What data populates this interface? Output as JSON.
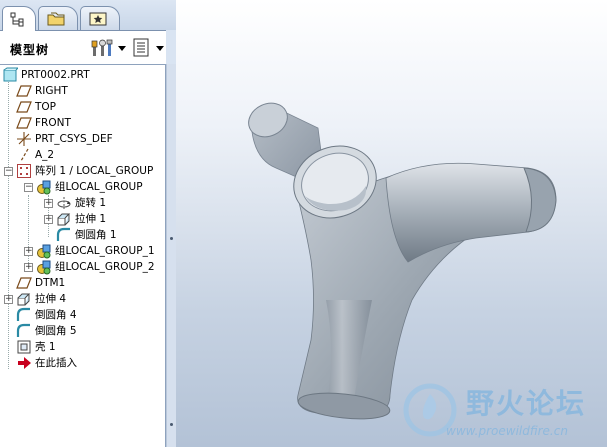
{
  "panel": {
    "title": "模型树"
  },
  "tabs": [
    {
      "name": "model-tree",
      "icon": "model-tree-icon",
      "active": true
    },
    {
      "name": "folder-browser",
      "icon": "folder-icon",
      "active": false
    },
    {
      "name": "favorites",
      "icon": "favorites-icon",
      "active": false
    }
  ],
  "tree": {
    "items": [
      {
        "label": "PRT0002.PRT",
        "icon": "part-icon"
      },
      {
        "label": "RIGHT",
        "icon": "datum-plane-icon"
      },
      {
        "label": "TOP",
        "icon": "datum-plane-icon"
      },
      {
        "label": "FRONT",
        "icon": "datum-plane-icon"
      },
      {
        "label": "PRT_CSYS_DEF",
        "icon": "csys-icon"
      },
      {
        "label": "A_2",
        "icon": "datum-axis-icon"
      },
      {
        "label": "阵列 1 / LOCAL_GROUP",
        "icon": "pattern-icon"
      },
      {
        "label": "组LOCAL_GROUP",
        "icon": "group-icon"
      },
      {
        "label": "旋转 1",
        "icon": "revolve-icon"
      },
      {
        "label": "拉伸 1",
        "icon": "extrude-icon"
      },
      {
        "label": "倒圆角 1",
        "icon": "round-icon"
      },
      {
        "label": "组LOCAL_GROUP_1",
        "icon": "group-icon"
      },
      {
        "label": "组LOCAL_GROUP_2",
        "icon": "group-icon"
      },
      {
        "label": "DTM1",
        "icon": "datum-plane-icon"
      },
      {
        "label": "拉伸 4",
        "icon": "extrude-icon"
      },
      {
        "label": "倒圆角 4",
        "icon": "round-icon"
      },
      {
        "label": "倒圆角 5",
        "icon": "round-icon"
      },
      {
        "label": "壳 1",
        "icon": "shell-icon"
      },
      {
        "label": "在此插入",
        "icon": "insert-here-arrow-icon"
      }
    ]
  },
  "watermark": {
    "title": "野火论坛",
    "url": "www.proewildfire.cn"
  },
  "colors": {
    "panel_bg": "#d9e4f2",
    "tree_bg": "#ffffff",
    "viewport_top": "#ffffff",
    "viewport_bottom": "#b3c2d6",
    "model": "#9aa4ae",
    "insert_arrow": "#c8001e"
  }
}
